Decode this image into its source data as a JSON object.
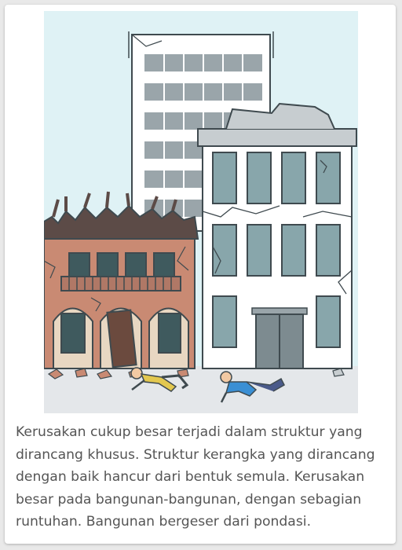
{
  "caption": "Kerusakan cukup besar terjadi dalam struktur yang dirancang khusus. Struktur kerangka yang dirancang dengan baik hancur dari bentuk semula. Kerusakan besar pada bangunan-bangunan, dengan sebagian runtuhan. Bangunan bergeser dari pondasi.",
  "colors": {
    "sky": "#dff2f5",
    "ground": "#e4e7ea",
    "window_glass": "#88a6ab",
    "brick": "#c98a73",
    "roof": "#5c4b47",
    "outline": "#3f4a4f"
  },
  "icons": [
    "damaged-office-tower",
    "cracked-white-building",
    "collapsed-brick-house",
    "crawling-person-yellow",
    "crawling-person-blue",
    "rubble"
  ]
}
